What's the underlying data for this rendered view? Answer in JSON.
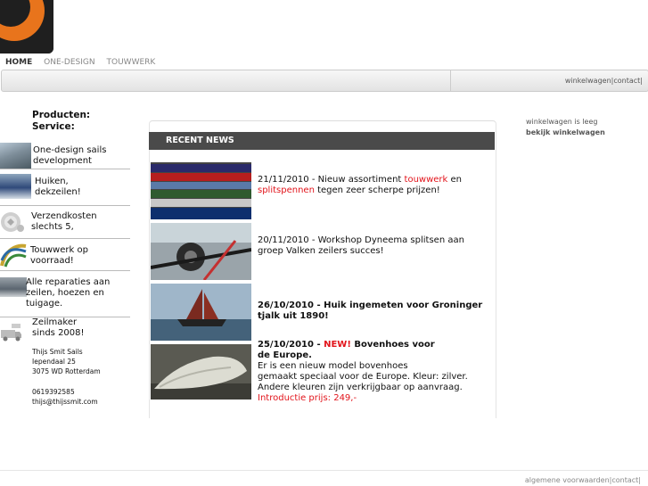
{
  "nav": {
    "home": "HOME",
    "one_design": "ONE-DESIGN",
    "touwwerk": "TOUWWERK"
  },
  "toplinks": {
    "cart": "winkelwagen",
    "sep1": "|",
    "contact": "contact",
    "sep2": "|"
  },
  "sidebar": {
    "heading_1": "Producten:",
    "heading_2": "Service:",
    "items": [
      {
        "line1": "One-design sails",
        "line2": "development"
      },
      {
        "line1": "Huiken,",
        "line2": "dekzeilen!"
      },
      {
        "line1": "Verzendkosten",
        "line2": "slechts 5,"
      },
      {
        "line1": "Touwwerk op",
        "line2": "voorraad!"
      },
      {
        "line1": "Alle reparaties aan",
        "line2": "zeilen, hoezen en",
        "line3": "tuigage."
      },
      {
        "line1": "Zeilmaker",
        "line2": "sinds 2008!"
      }
    ],
    "address": {
      "name": "Thijs Smit Sails",
      "street": "Iependaal 25",
      "city": "3075 WD Rotterdam",
      "phone": "0619392585",
      "email": "thijs@thijssmit.com"
    }
  },
  "news": {
    "header": "RECENT NEWS",
    "items": [
      {
        "date": "21/11/2010 - Nieuw assortiment ",
        "link1": "touwwerk",
        "mid": " en",
        "link2": "splitspennen",
        "rest": " tegen zeer scherpe prijzen!"
      },
      {
        "line1": "20/11/2010 - Workshop Dyneema splitsen aan",
        "line2": "groep Valken zeilers succes!"
      },
      {
        "line1": "26/10/2010 - Huik ingemeten voor Groninger",
        "line2": "tjalk uit 1890!"
      },
      {
        "date": "25/10/2010 - ",
        "new": "NEW!",
        "title": " Bovenhoes voor",
        "title2": "de Europe.",
        "body1": "Er is een nieuw model bovenhoes",
        "body2": "gemaakt speciaal voor de Europe. Kleur: zilver.",
        "body3": "Andere kleuren zijn verkrijgbaar op aanvraag.",
        "price": "Introductie prijs: 249,-"
      }
    ]
  },
  "cart": {
    "empty": "winkelwagen is leeg",
    "view": "bekijk winkelwagen"
  },
  "footer": {
    "terms": "algemene voorwaarden",
    "sep1": "|",
    "contact": "contact",
    "sep2": "|"
  },
  "colors": {
    "accent_red": "#e2141b",
    "logo_orange": "#e8741c",
    "news_header_bg": "#4a4a4a"
  }
}
